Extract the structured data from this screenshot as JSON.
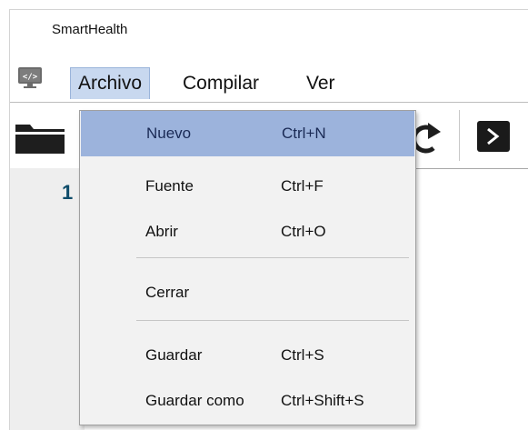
{
  "app": {
    "title": "SmartHealth"
  },
  "menubar": {
    "items": [
      {
        "label": "Archivo"
      },
      {
        "label": "Compilar"
      },
      {
        "label": "Ver"
      }
    ]
  },
  "editor": {
    "first_line_number": "1"
  },
  "dropdown": {
    "items": [
      {
        "label": "Nuevo",
        "shortcut": "Ctrl+N"
      },
      {
        "label": "Fuente",
        "shortcut": "Ctrl+F"
      },
      {
        "label": "Abrir",
        "shortcut": "Ctrl+O"
      },
      {
        "label": "Cerrar",
        "shortcut": ""
      },
      {
        "label": "Guardar",
        "shortcut": "Ctrl+S"
      },
      {
        "label": "Guardar como",
        "shortcut": "Ctrl+Shift+S"
      }
    ]
  },
  "icons": {
    "app": "code-window-icon",
    "open": "folder-icon",
    "redo": "redo-icon",
    "run": "run-icon"
  },
  "colors": {
    "highlight": "#9cb3dc",
    "menu_open": "#c8d8ef",
    "gutter": "#eeeeee",
    "line_number": "#0e4c6a"
  }
}
